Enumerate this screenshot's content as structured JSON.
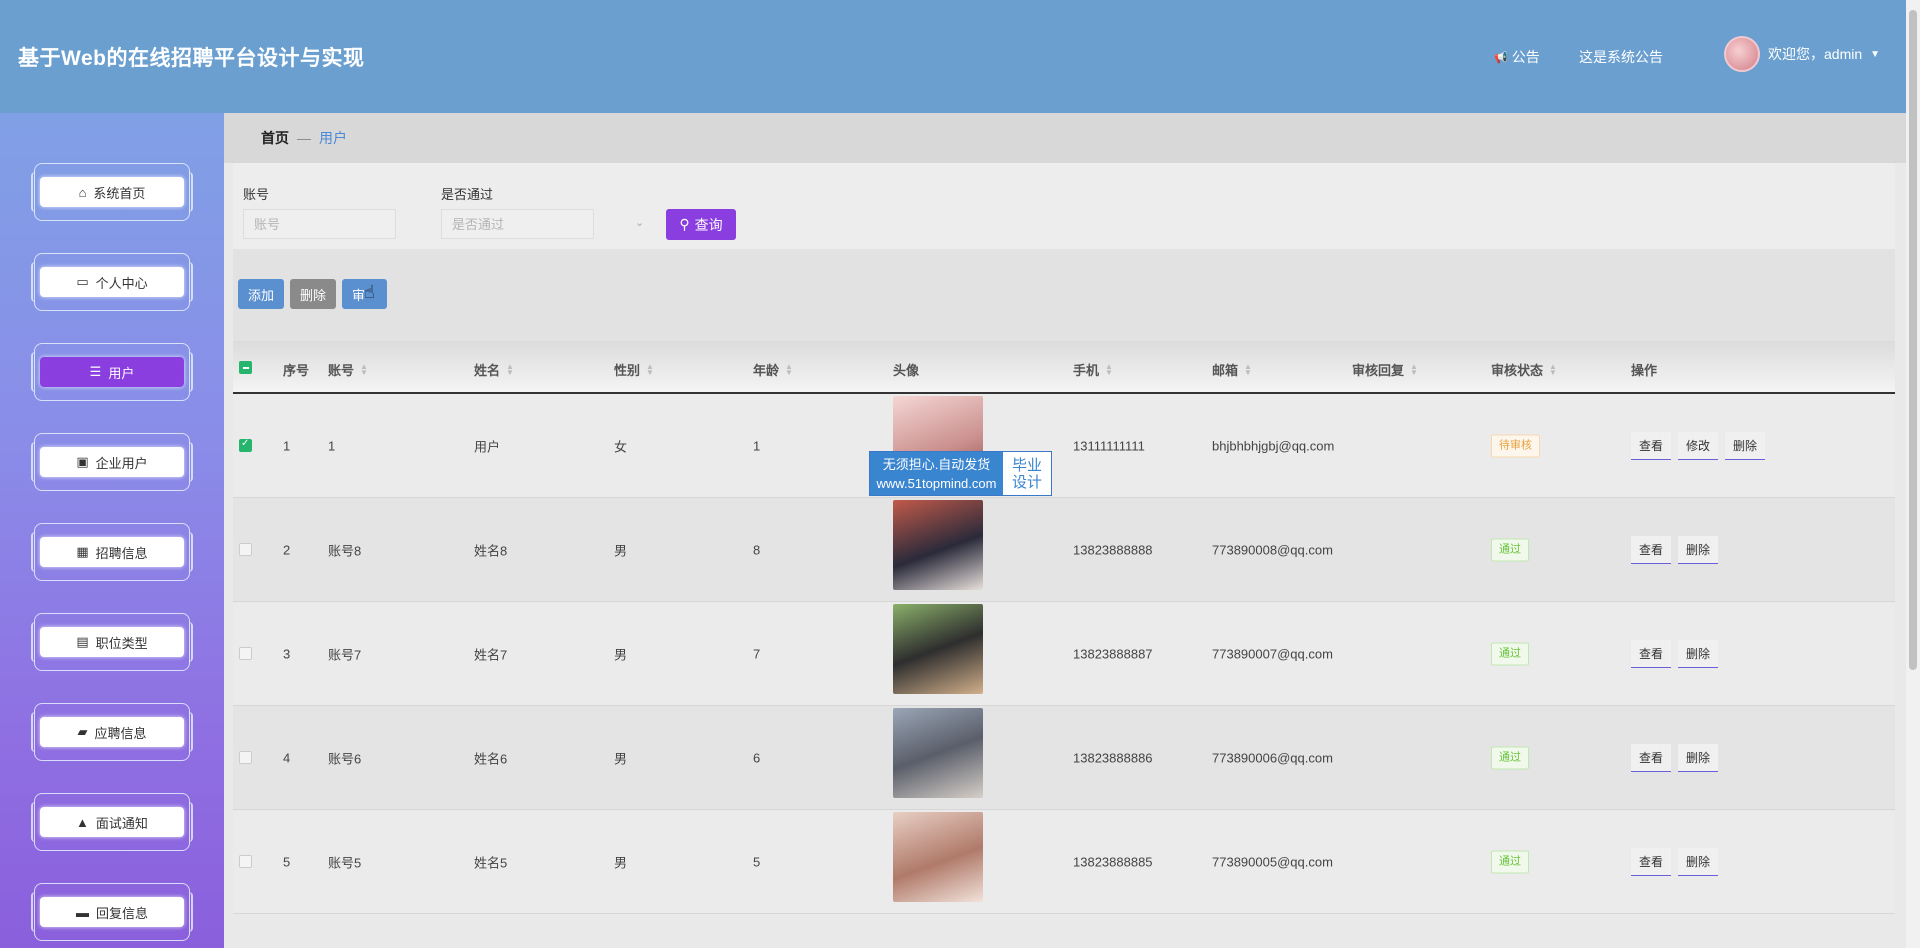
{
  "header": {
    "title": "基于Web的在线招聘平台设计与实现",
    "notice_label": "公告",
    "notice_text": "这是系统公告",
    "welcome": "欢迎您，admin"
  },
  "sidebar": {
    "items": [
      {
        "label": "系统首页",
        "icon": "home-icon"
      },
      {
        "label": "个人中心",
        "icon": "card-icon"
      },
      {
        "label": "用户",
        "icon": "menu-lines-icon"
      },
      {
        "label": "企业用户",
        "icon": "badge-icon"
      },
      {
        "label": "招聘信息",
        "icon": "grid-icon"
      },
      {
        "label": "职位类型",
        "icon": "clipboard-icon"
      },
      {
        "label": "应聘信息",
        "icon": "ticket-icon"
      },
      {
        "label": "面试通知",
        "icon": "user-icon"
      },
      {
        "label": "回复信息",
        "icon": "monitor-icon"
      }
    ],
    "active_index": 2
  },
  "breadcrumb": {
    "home": "首页",
    "separator": "—",
    "current": "用户"
  },
  "search": {
    "account_label": "账号",
    "account_placeholder": "账号",
    "approved_label": "是否通过",
    "approved_placeholder": "是否通过",
    "query_button": "查询"
  },
  "actions": {
    "add": "添加",
    "delete": "删除",
    "review": "审"
  },
  "table": {
    "headers": {
      "index": "序号",
      "account": "账号",
      "name": "姓名",
      "gender": "性别",
      "age": "年龄",
      "photo": "头像",
      "phone": "手机",
      "email": "邮箱",
      "reply": "审核回复",
      "status": "审核状态",
      "ops": "操作"
    },
    "rows": [
      {
        "index": "1",
        "account": "1",
        "name": "用户",
        "gender": "女",
        "age": "1",
        "phone": "13111111111",
        "email": "bhjbhbhjgbj@qq.com",
        "status": "待审核",
        "status_type": "pending",
        "ops": [
          "查看",
          "修改",
          "删除"
        ],
        "checked": true
      },
      {
        "index": "2",
        "account": "账号8",
        "name": "姓名8",
        "gender": "男",
        "age": "8",
        "phone": "13823888888",
        "email": "773890008@qq.com",
        "status": "通过",
        "status_type": "pass",
        "ops": [
          "查看",
          "删除"
        ],
        "checked": false
      },
      {
        "index": "3",
        "account": "账号7",
        "name": "姓名7",
        "gender": "男",
        "age": "7",
        "phone": "13823888887",
        "email": "773890007@qq.com",
        "status": "通过",
        "status_type": "pass",
        "ops": [
          "查看",
          "删除"
        ],
        "checked": false
      },
      {
        "index": "4",
        "account": "账号6",
        "name": "姓名6",
        "gender": "男",
        "age": "6",
        "phone": "13823888886",
        "email": "773890006@qq.com",
        "status": "通过",
        "status_type": "pass",
        "ops": [
          "查看",
          "删除"
        ],
        "checked": false
      },
      {
        "index": "5",
        "account": "账号5",
        "name": "姓名5",
        "gender": "男",
        "age": "5",
        "phone": "13823888885",
        "email": "773890005@qq.com",
        "status": "通过",
        "status_type": "pass",
        "ops": [
          "查看",
          "删除"
        ],
        "checked": false
      }
    ]
  },
  "watermark": {
    "line1": "无须担心.自动发货",
    "line2": "www.51topmind.com",
    "right1": "毕业",
    "right2": "设计"
  },
  "colors": {
    "header": "#6a9fd0",
    "accent": "#8a3ee0",
    "action_blue": "#5a8fd0",
    "action_gray": "#8a8a8a",
    "check_green": "#26b56d"
  }
}
